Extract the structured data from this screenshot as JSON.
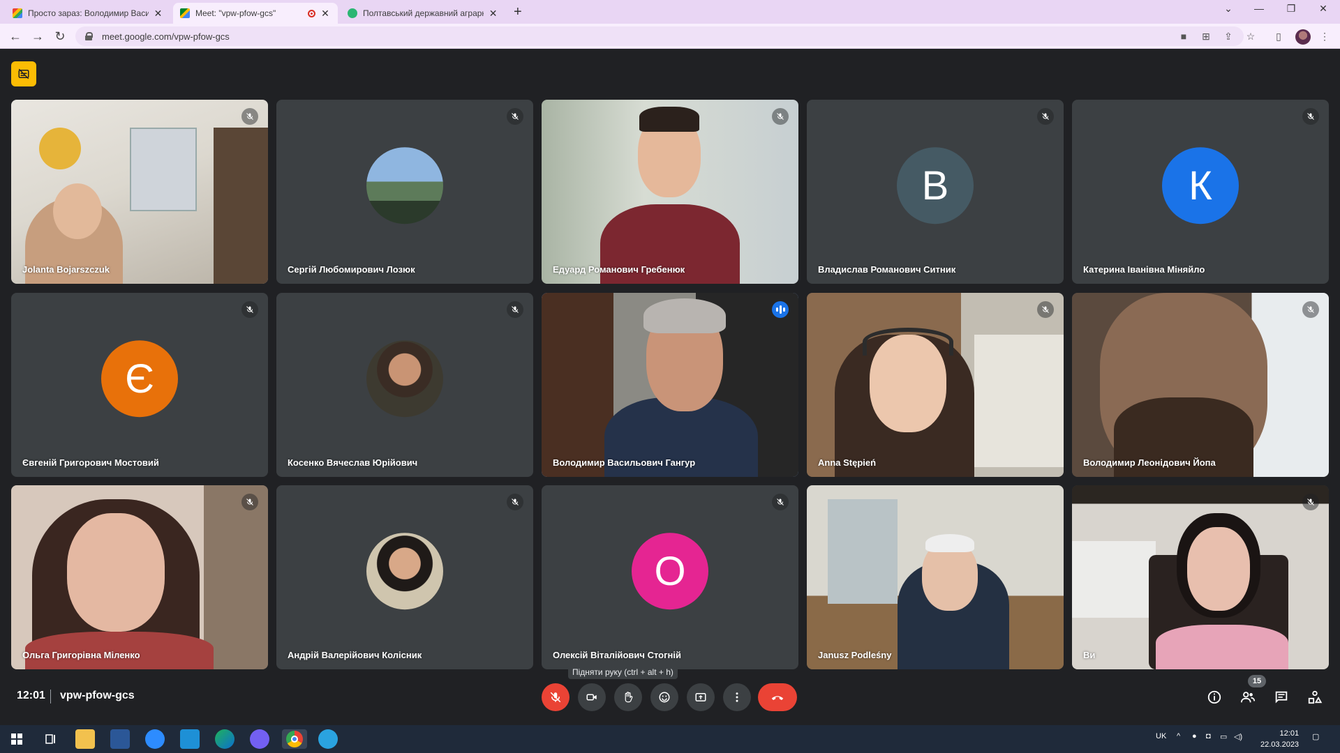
{
  "browser": {
    "tabs": [
      {
        "title": "Просто зараз: Володимир Васи...",
        "favicon": "gmail-icon",
        "active": false
      },
      {
        "title": "Meet: \"vpw-pfow-gcs\"",
        "favicon": "meet-icon",
        "active": true,
        "recording": true
      },
      {
        "title": "Полтавський державний аграрн...",
        "favicon": "site-icon",
        "active": false
      }
    ],
    "url": "meet.google.com/vpw-pfow-gcs"
  },
  "meeting": {
    "time": "12:01",
    "code": "vpw-pfow-gcs",
    "participant_count": "15",
    "tooltip": "Підняти руку (ctrl + alt + h)"
  },
  "participants": [
    {
      "name": "Jolanta Bojarszczuk",
      "type": "video",
      "muted": true
    },
    {
      "name": "Сергій Любомирович Лозюк",
      "type": "photo",
      "muted": true
    },
    {
      "name": "Едуард Романович Гребенюк",
      "type": "video",
      "muted": true
    },
    {
      "name": "Владислав Романович Ситник",
      "type": "letter",
      "letter": "В",
      "color": "#455a64",
      "muted": true
    },
    {
      "name": "Катерина Іванівна Міняйло",
      "type": "letter",
      "letter": "К",
      "color": "#1a73e8",
      "muted": true
    },
    {
      "name": "Євгеній Григорович Мостовий",
      "type": "letter",
      "letter": "Є",
      "color": "#e8710a",
      "muted": true
    },
    {
      "name": "Косенко Вячеслав Юрійович",
      "type": "photo",
      "muted": true
    },
    {
      "name": "Володимир Васильович Гангур",
      "type": "video",
      "muted": false,
      "speaking": true
    },
    {
      "name": "Anna Stępień",
      "type": "video",
      "muted": true
    },
    {
      "name": "Володимир Леонідович Йопа",
      "type": "video",
      "muted": true
    },
    {
      "name": "Ольга Григорівна Міленко",
      "type": "video",
      "muted": true
    },
    {
      "name": "Андрій Валерійович Колісник",
      "type": "photo",
      "muted": true
    },
    {
      "name": "Олексій Віталійович Стогній",
      "type": "letter",
      "letter": "О",
      "color": "#e52592",
      "muted": true
    },
    {
      "name": "Janusz Podleśny",
      "type": "video",
      "muted": false
    },
    {
      "name": "Ви",
      "type": "video",
      "muted": true
    }
  ],
  "taskbar": {
    "language": "UK",
    "time": "12:01",
    "date": "22.03.2023"
  },
  "colors": {
    "background": "#202124",
    "tile": "#3c4043",
    "end_call": "#ea4335",
    "speaking_border": "#8ab4f8",
    "captions_button": "#fbbc04"
  }
}
